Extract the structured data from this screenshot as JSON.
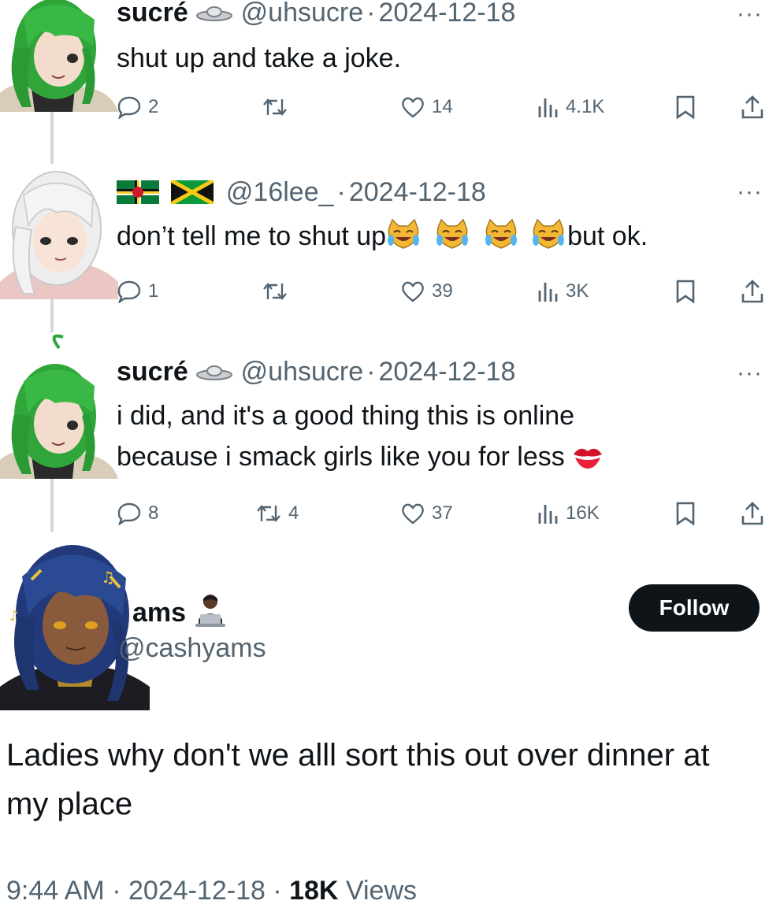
{
  "tweets": [
    {
      "name": "sucré",
      "name_emoji": "ufo-icon",
      "handle": "@uhsucre",
      "sep": "·",
      "date": "2024-12-18",
      "more": "···",
      "text": "shut up and take a joke.",
      "reply_count": "2",
      "retweet_count": "",
      "like_count": "14",
      "view_count": "4.1K"
    },
    {
      "name": "",
      "name_emoji": "dominica-flag jamaica-flag",
      "handle": "@16lee_",
      "sep": "·",
      "date": "2024-12-18",
      "more": "···",
      "text_before": "don’t tell me to shut up",
      "text_emoji": "crying-laughing-cat-icon ×4",
      "text_after": "but ok.",
      "reply_count": "1",
      "retweet_count": "",
      "like_count": "39",
      "view_count": "3K"
    },
    {
      "name": "sucré",
      "name_emoji": "ufo-icon",
      "handle": "@uhsucre",
      "sep": "·",
      "date": "2024-12-18",
      "more": "···",
      "text_line1": "i did, and it's a good thing this is online",
      "text_line2": "because i smack girls like you for less",
      "text_emoji": "kiss-mark-icon",
      "reply_count": "8",
      "retweet_count": "4",
      "like_count": "37",
      "view_count": "16K"
    }
  ],
  "main_tweet": {
    "name": "ams",
    "name_emoji": "technologist-icon",
    "handle": "@cashyams",
    "follow_label": "Follow",
    "text": "Ladies why don't we alll sort this out over dinner at my place",
    "time": "9:44 AM",
    "sep1": " · ",
    "date": "2024-12-18",
    "sep2": " · ",
    "views_count": "18K",
    "views_label": " Views"
  },
  "colors": {
    "text": "#0f1419",
    "muted": "#536471",
    "thread_line": "#cfd9de",
    "button_bg": "#0f1419"
  }
}
